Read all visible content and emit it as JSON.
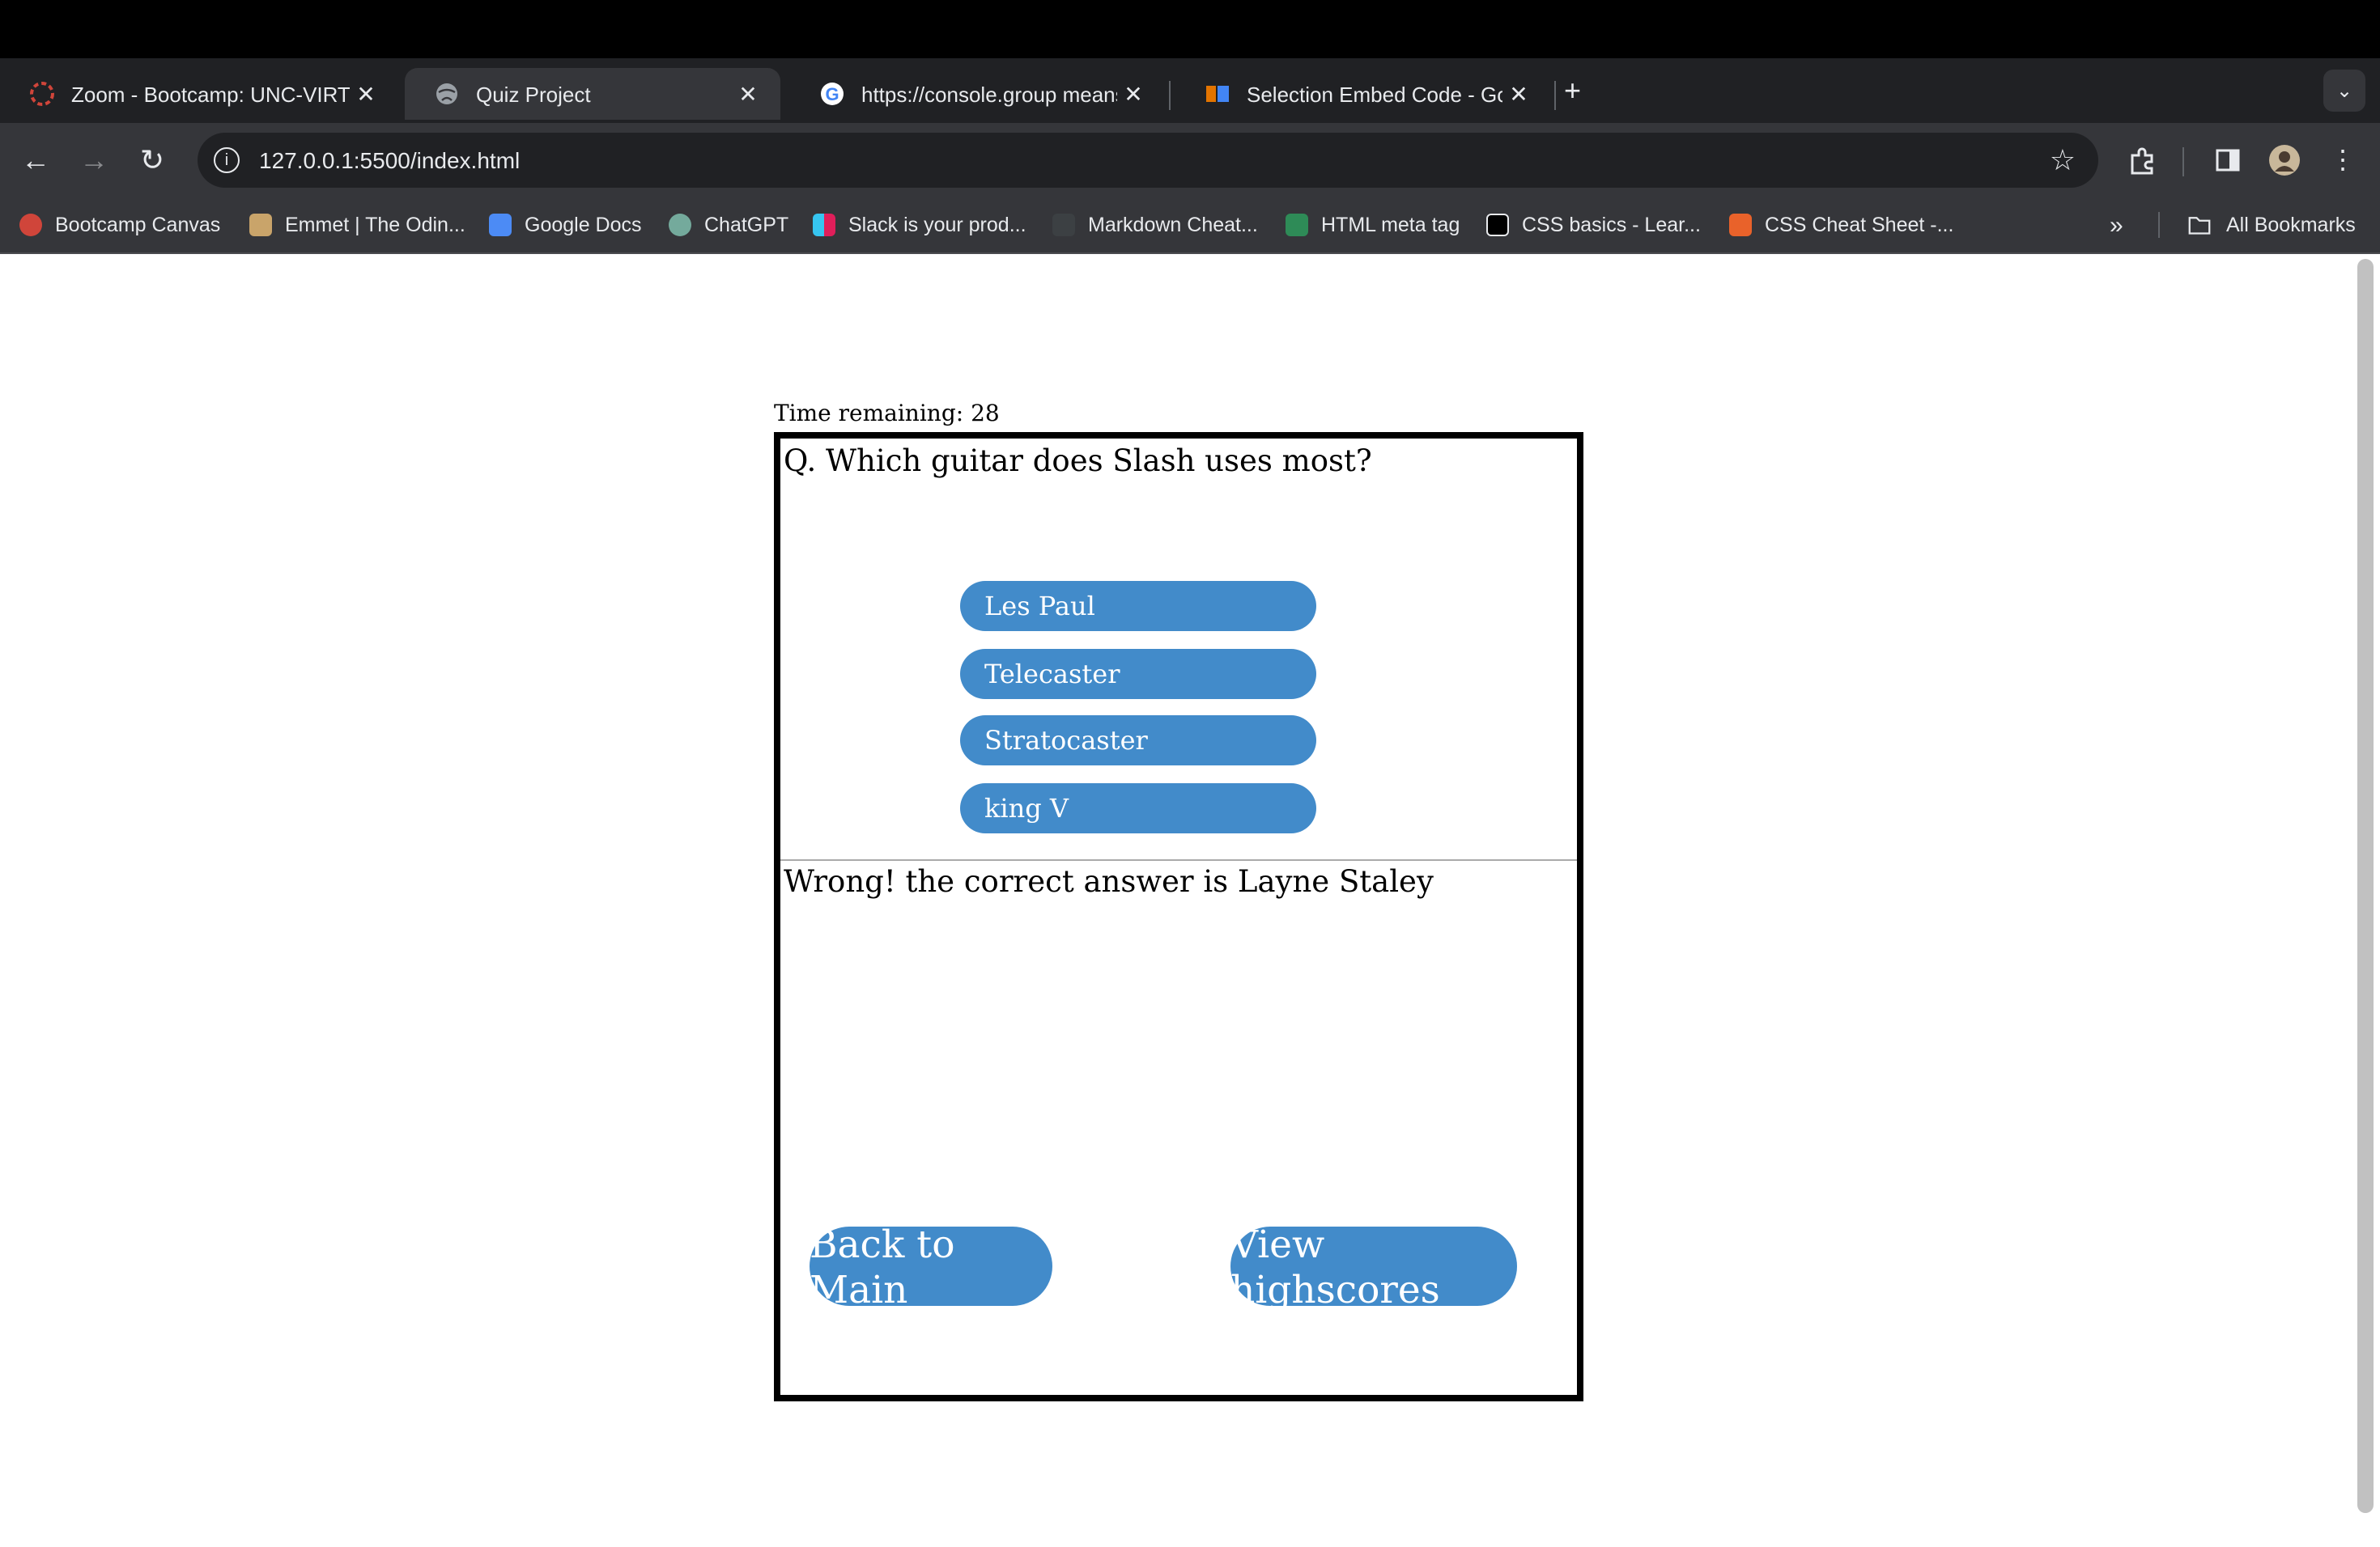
{
  "browser": {
    "tabs": [
      {
        "title": "Zoom - Bootcamp: UNC-VIRT"
      },
      {
        "title": "Quiz Project"
      },
      {
        "title": "https://console.group means"
      },
      {
        "title": "Selection Embed Code - Goo"
      }
    ],
    "address": "127.0.0.1:5500/index.html",
    "bookmarks": [
      {
        "label": "Bootcamp Canvas",
        "color": "#d0453a"
      },
      {
        "label": "Emmet | The Odin...",
        "color": "#c9a46a"
      },
      {
        "label": "Google Docs",
        "color": "#4c8bf5"
      },
      {
        "label": "ChatGPT",
        "color": "#74aa9c"
      },
      {
        "label": "Slack is your prod...",
        "color": "#e01e5a"
      },
      {
        "label": "Markdown Cheat...",
        "color": "#3c4043"
      },
      {
        "label": "HTML meta tag",
        "color": "#2e8b57"
      },
      {
        "label": "CSS basics - Lear...",
        "color": "#000000"
      },
      {
        "label": "CSS Cheat Sheet -...",
        "color": "#e9622a"
      }
    ],
    "all_bookmarks": "All Bookmarks"
  },
  "quiz": {
    "timer": "Time remaining: 28",
    "question": "Q. Which guitar does Slash uses most?",
    "answers": [
      "Les Paul",
      "Telecaster",
      "Stratocaster",
      "king V"
    ],
    "feedback": "Wrong! the correct answer is Layne Staley",
    "back_button": "Back to Main",
    "highscores_button": "View highscores",
    "accent_color": "#428bca"
  }
}
